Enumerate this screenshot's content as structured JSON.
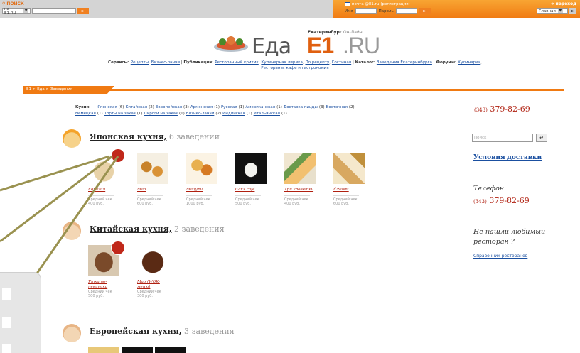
{
  "topbar": {
    "search_label": "ПОИСК",
    "search_scope": "на E1.RU",
    "go_symbol": "►",
    "mail_link": "почта @E1.ru",
    "register_link": "(регистрация)",
    "login_label": "Имя",
    "password_label": "Пароль",
    "jump_label": "переход",
    "jump_select": "Главная",
    "mail_icon": "envelope-icon"
  },
  "logo": {
    "city": "Екатеринбург",
    "city_suffix": "Он-Лайн",
    "eda": "Еда",
    "e1": "E1",
    "ru": ".RU"
  },
  "services": {
    "label_services": "Сервисы:",
    "services": [
      "Рецепты",
      "Бизнес-ланчи"
    ],
    "label_pubs": "Публикации:",
    "pubs": [
      "Ресторанный критик",
      "Кулинарная лирика",
      "По рецепту",
      "Гостиная"
    ],
    "label_catalog": "Каталог:",
    "catalog": [
      "Заведения Екатеринбурга"
    ],
    "label_forums": "Форумы:",
    "forums": [
      "Кулинария"
    ],
    "line2": "Рестораны, кафе и гастрономия"
  },
  "breadcrumb": "E1 > Еда > Заведения",
  "cuisines_label": "Кухни:",
  "cuisines": [
    {
      "name": "Японская",
      "count": "(6)"
    },
    {
      "name": "Китайская",
      "count": "(2)"
    },
    {
      "name": "Европейская",
      "count": "(3)"
    },
    {
      "name": "Армянская",
      "count": "(1)"
    },
    {
      "name": "Русская",
      "count": "(1)"
    },
    {
      "name": "Американская",
      "count": "(1)"
    },
    {
      "name": "Доставка пиццы",
      "count": "(3)"
    },
    {
      "name": "Восточная",
      "count": "(2)"
    },
    {
      "name": "Немецкая",
      "count": "(1)"
    },
    {
      "name": "Торты на заказ",
      "count": "(1)"
    },
    {
      "name": "Пироги на заказ",
      "count": "(1)"
    },
    {
      "name": "Бизнес-ланчи",
      "count": "(2)"
    },
    {
      "name": "Индийская",
      "count": "(1)"
    },
    {
      "name": "Итальянская",
      "count": "(1)"
    }
  ],
  "phone": {
    "code": "(343)",
    "number": "379-82-69"
  },
  "sidebar": {
    "search_placeholder": "Поиск",
    "search_btn": "↵",
    "delivery_link": "Условия доставки",
    "tel_label": "Телефон",
    "notfound": "Не нашли любимый ресторан ?",
    "directory_link": "Справочник ресторанов"
  },
  "sections": [
    {
      "name": "Японская кухня,",
      "count": "6 заведений",
      "cards": [
        {
          "name": "Евразия",
          "avg": "Средний чек",
          "price": "400 руб."
        },
        {
          "name": "Мао",
          "avg": "Средний чек",
          "price": "600 руб."
        },
        {
          "name": "Мацури",
          "avg": "Средний чек",
          "price": "1000 руб."
        },
        {
          "name": "Cat's café",
          "avg": "Средний чек",
          "price": "500 руб."
        },
        {
          "name": "Три креветки",
          "avg": "Средний чек",
          "price": "400 руб."
        },
        {
          "name": "Ё!Sushi",
          "avg": "Средний чек",
          "price": "600 руб."
        }
      ]
    },
    {
      "name": "Китайская кухня,",
      "count": "2 заведения",
      "cards": [
        {
          "name": "Утка по-пекински",
          "avg": "Средний чек",
          "price": "500 руб."
        },
        {
          "name": "Мао (WOK-меню)",
          "avg": "Средний чек",
          "price": "300 руб."
        }
      ]
    },
    {
      "name": "Европейская кухня,",
      "count": "3 заведения",
      "cards": []
    }
  ]
}
